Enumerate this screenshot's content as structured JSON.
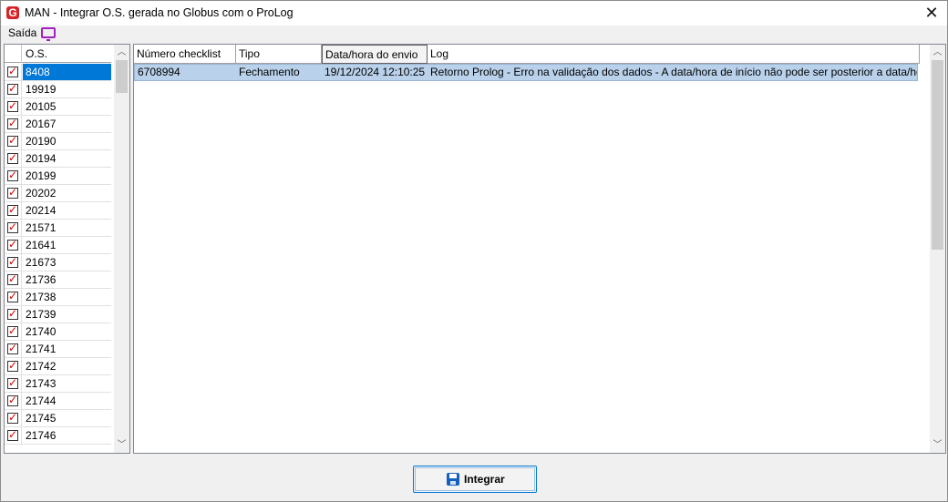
{
  "window": {
    "title": "MAN - Integrar O.S. gerada no Globus com o ProLog",
    "app_icon_letter": "G",
    "close_glyph": "✕"
  },
  "menu": {
    "saida_label": "Saída",
    "saida_icon": "monitor-icon"
  },
  "os_grid": {
    "header": "O.S.",
    "rows": [
      {
        "os": "8408",
        "checked": true,
        "selected": true
      },
      {
        "os": "19919",
        "checked": true
      },
      {
        "os": "20105",
        "checked": true
      },
      {
        "os": "20167",
        "checked": true
      },
      {
        "os": "20190",
        "checked": true
      },
      {
        "os": "20194",
        "checked": true
      },
      {
        "os": "20199",
        "checked": true
      },
      {
        "os": "20202",
        "checked": true
      },
      {
        "os": "20214",
        "checked": true
      },
      {
        "os": "21571",
        "checked": true
      },
      {
        "os": "21641",
        "checked": true
      },
      {
        "os": "21673",
        "checked": true
      },
      {
        "os": "21736",
        "checked": true
      },
      {
        "os": "21738",
        "checked": true
      },
      {
        "os": "21739",
        "checked": true
      },
      {
        "os": "21740",
        "checked": true
      },
      {
        "os": "21741",
        "checked": true
      },
      {
        "os": "21742",
        "checked": true
      },
      {
        "os": "21743",
        "checked": true
      },
      {
        "os": "21744",
        "checked": true
      },
      {
        "os": "21745",
        "checked": true
      },
      {
        "os": "21746",
        "checked": true
      }
    ]
  },
  "log_grid": {
    "headers": [
      "Número checklist",
      "Tipo",
      "Data/hora do envio",
      "Log"
    ],
    "rows": [
      {
        "numero": "6708994",
        "tipo": "Fechamento",
        "data_hora": "19/12/2024 12:10:25",
        "log": "Retorno Prolog - Erro na validação dos dados - A data/hora de início não pode ser posterior a data/hora fim do ..."
      }
    ]
  },
  "footer": {
    "integrar_label": "Integrar"
  },
  "colors": {
    "selection": "#0078d7",
    "row_highlight": "#b9d1ea",
    "check_mark": "#d00000",
    "app_icon": "#d6252a"
  }
}
